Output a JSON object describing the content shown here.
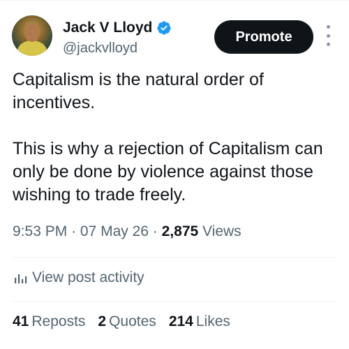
{
  "author": {
    "name": "Jack V Lloyd",
    "handle": "@jackvlloyd",
    "verified": true
  },
  "actions": {
    "promote_label": "Promote",
    "more_icon": "more-vertical-icon"
  },
  "post": {
    "text": "Capitalism is the natural order of incentives.\n\nThis is why a rejection of Capitalism can only be done by violence against those wishing to trade freely.",
    "time": "9:53 PM",
    "date": "07 May 26",
    "views_count": "2,875",
    "views_label": "Views"
  },
  "activity": {
    "label": "View post activity",
    "icon": "analytics-icon"
  },
  "stats": {
    "reposts_count": "41",
    "reposts_label": "Reposts",
    "quotes_count": "2",
    "quotes_label": "Quotes",
    "likes_count": "214",
    "likes_label": "Likes"
  },
  "colors": {
    "text": "#0f1419",
    "secondary": "#536471",
    "verified": "#1d9bf0",
    "button_bg": "#0f1419"
  }
}
